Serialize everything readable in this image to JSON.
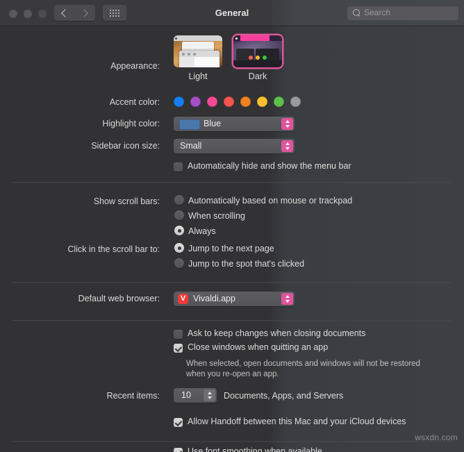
{
  "window": {
    "title": "General",
    "traffic_lights": [
      "close",
      "minimize",
      "maximize"
    ],
    "nav": {
      "back": "back-arrow",
      "forward": "forward-arrow",
      "grid": "show-all-grid"
    },
    "search": {
      "placeholder": "Search",
      "value": ""
    }
  },
  "appearance": {
    "label": "Appearance:",
    "options": [
      {
        "name": "Light",
        "selected": false
      },
      {
        "name": "Dark",
        "selected": true
      }
    ]
  },
  "accent_color": {
    "label": "Accent color:",
    "selected": "Pink",
    "swatches": [
      {
        "name": "Blue",
        "hex": "#167ef2"
      },
      {
        "name": "Purple",
        "hex": "#a350c6"
      },
      {
        "name": "Pink",
        "hex": "#f24a96"
      },
      {
        "name": "Red",
        "hex": "#f7544f"
      },
      {
        "name": "Orange",
        "hex": "#f08223"
      },
      {
        "name": "Yellow",
        "hex": "#fcc02e"
      },
      {
        "name": "Green",
        "hex": "#5dbf49"
      },
      {
        "name": "Graphite",
        "hex": "#9a9a9c"
      }
    ]
  },
  "highlight_color": {
    "label": "Highlight color:",
    "value": "Blue",
    "swatch_hex": "#4a77ab"
  },
  "sidebar_icon_size": {
    "label": "Sidebar icon size:",
    "value": "Small"
  },
  "menu_bar": {
    "checkbox_label": "Automatically hide and show the menu bar",
    "checked": false
  },
  "scroll_bars": {
    "label": "Show scroll bars:",
    "options": [
      {
        "label": "Automatically based on mouse or trackpad",
        "selected": false
      },
      {
        "label": "When scrolling",
        "selected": false
      },
      {
        "label": "Always",
        "selected": true
      }
    ]
  },
  "scroll_bar_click": {
    "label": "Click in the scroll bar to:",
    "options": [
      {
        "label": "Jump to the next page",
        "selected": true
      },
      {
        "label": "Jump to the spot that's clicked",
        "selected": false
      }
    ]
  },
  "default_browser": {
    "label": "Default web browser:",
    "value": "Vivaldi.app",
    "icon": "vivaldi-icon",
    "icon_hex": "#ef3939"
  },
  "documents": {
    "ask_keep_changes": {
      "label": "Ask to keep changes when closing documents",
      "checked": false
    },
    "close_windows": {
      "label": "Close windows when quitting an app",
      "checked": true
    },
    "help_line_1": "When selected, open documents and windows will not be restored",
    "help_line_2": "when you re-open an app."
  },
  "recent_items": {
    "label": "Recent items:",
    "value": "10",
    "suffix": "Documents, Apps, and Servers"
  },
  "handoff": {
    "label": "Allow Handoff between this Mac and your iCloud devices",
    "checked": true
  },
  "font_smoothing": {
    "label": "Use font smoothing when available",
    "checked": true
  },
  "watermark": "wsxdn.com"
}
